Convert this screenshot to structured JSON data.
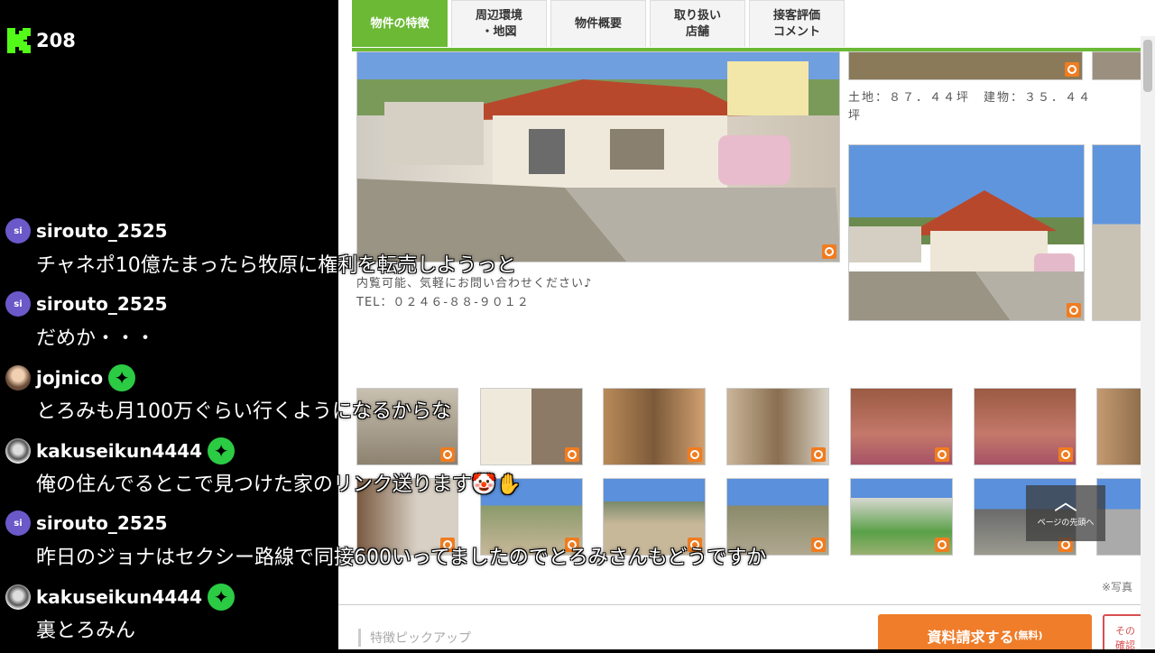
{
  "overlay": {
    "viewer_count": "208",
    "brand_icon": "kick-logo-icon"
  },
  "tabs": [
    {
      "label": "物件の特徴",
      "active": true
    },
    {
      "label": "周辺環境\n・地図",
      "active": false
    },
    {
      "label": "物件概要",
      "active": false
    },
    {
      "label": "取り扱い\n店舗",
      "active": false
    },
    {
      "label": "接客評価\nコメント",
      "active": false
    }
  ],
  "listing": {
    "viewing_note": "内覧可能、気軽にお問い合わせください♪",
    "tel": "TEL：０２４６-８８-９０１２",
    "floor_area": "土地：８７．４４坪　建物：３５．４４坪",
    "photo_note": "※写真",
    "scroll_top_label": "ページの先頭へ",
    "feature_pickup": "特徴ピックアップ",
    "request_button": "資料請求する",
    "request_button_sub": "(無料)",
    "other_button": "その\n確認"
  },
  "chat": [
    {
      "user": "sirouto_2525",
      "avatar": "si",
      "avatar_type": "initials",
      "badge": false,
      "text": "チャネポ10億たまったら牧原に権利を転売しようっと"
    },
    {
      "user": "sirouto_2525",
      "avatar": "si",
      "avatar_type": "initials",
      "badge": false,
      "text": "だめか・・・"
    },
    {
      "user": "jojnico",
      "avatar": "",
      "avatar_type": "photo",
      "badge": true,
      "text": "とろみも月100万ぐらい行くようになるからな"
    },
    {
      "user": "kakuseikun4444",
      "avatar": "",
      "avatar_type": "bw",
      "badge": true,
      "text": "俺の住んでるとこで見つけた家のリンク送ります🤡✋"
    },
    {
      "user": "sirouto_2525",
      "avatar": "si",
      "avatar_type": "initials",
      "badge": false,
      "text": "昨日のジョナはセクシー路線で同接600いってましたのでとろみさんもどうですか"
    },
    {
      "user": "kakuseikun4444",
      "avatar": "",
      "avatar_type": "bw",
      "badge": true,
      "text": "裏とろみん"
    }
  ],
  "colors": {
    "tab_active": "#6bb935",
    "request_button": "#ef7d2a",
    "zoom_icon": "#f07c20",
    "avatar_default": "#6b58c9",
    "badge": "#2ccb44"
  }
}
